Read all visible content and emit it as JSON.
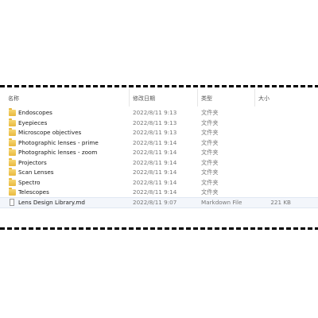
{
  "columns": {
    "name": "名称",
    "date": "修改日期",
    "type": "类型",
    "size": "大小"
  },
  "files": [
    {
      "name": "Endoscopes",
      "date": "2022/8/11 9:13",
      "type": "文件夹",
      "size": "",
      "icon": "folder-icon"
    },
    {
      "name": "Eyepieces",
      "date": "2022/8/11 9:13",
      "type": "文件夹",
      "size": "",
      "icon": "folder-icon"
    },
    {
      "name": "Microscope objectives",
      "date": "2022/8/11 9:13",
      "type": "文件夹",
      "size": "",
      "icon": "folder-icon"
    },
    {
      "name": "Photographic lenses - prime",
      "date": "2022/8/11 9:14",
      "type": "文件夹",
      "size": "",
      "icon": "folder-icon"
    },
    {
      "name": "Photographic lenses - zoom",
      "date": "2022/8/11 9:14",
      "type": "文件夹",
      "size": "",
      "icon": "folder-icon"
    },
    {
      "name": "Projectors",
      "date": "2022/8/11 9:14",
      "type": "文件夹",
      "size": "",
      "icon": "folder-icon"
    },
    {
      "name": "Scan Lenses",
      "date": "2022/8/11 9:14",
      "type": "文件夹",
      "size": "",
      "icon": "folder-icon"
    },
    {
      "name": "Spectro",
      "date": "2022/8/11 9:14",
      "type": "文件夹",
      "size": "",
      "icon": "folder-icon"
    },
    {
      "name": "Telescopes",
      "date": "2022/8/11 9:14",
      "type": "文件夹",
      "size": "",
      "icon": "folder-icon"
    },
    {
      "name": "Lens Design Library.md",
      "date": "2022/8/11 9:07",
      "type": "Markdown File",
      "size": "221 KB",
      "icon": "markdown-file-icon"
    }
  ]
}
